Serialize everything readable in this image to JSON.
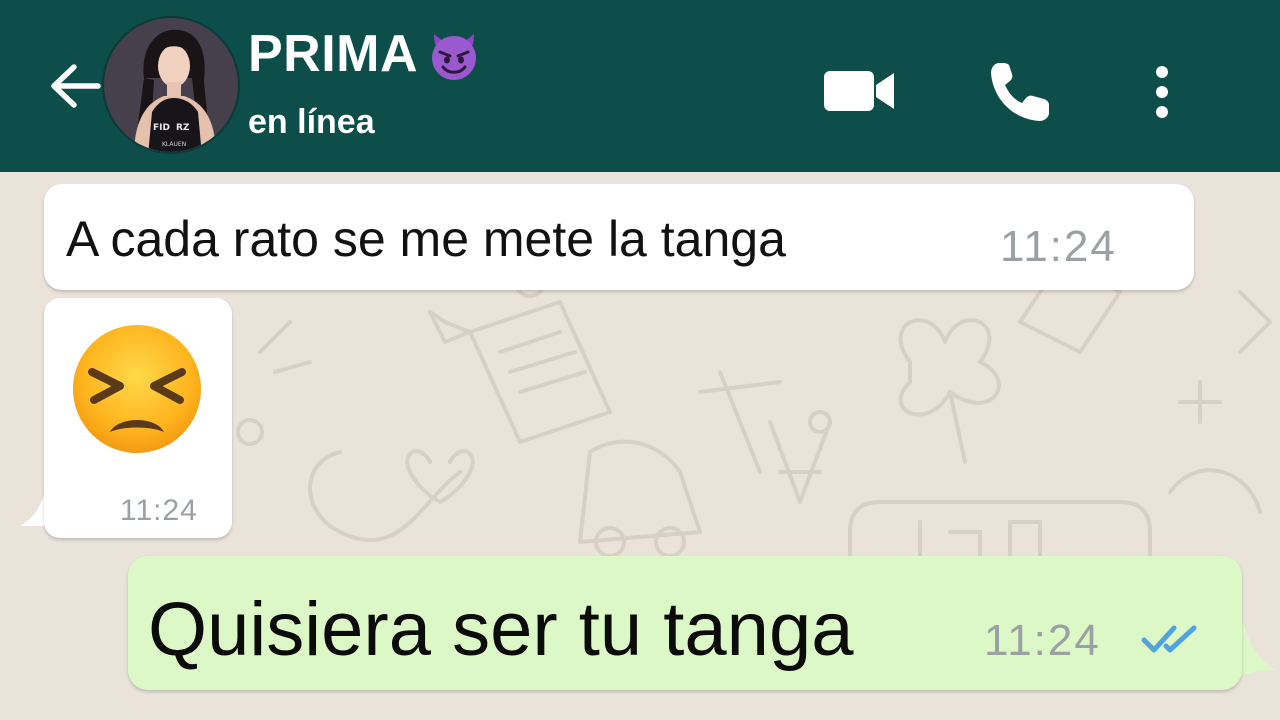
{
  "header": {
    "back_icon": "arrow-left-icon",
    "contact_name": "PRIMA",
    "contact_emoji": "smiling-face-with-horns-emoji",
    "status": "en línea",
    "avatar_text": [
      "FID",
      "RZ",
      "KLAUEN"
    ],
    "actions": [
      "video-call-icon",
      "phone-call-icon",
      "more-vertical-icon"
    ],
    "bg_color": "#0d4e4a"
  },
  "messages": [
    {
      "direction": "incoming",
      "text": "A cada rato se me mete la tanga",
      "time": "11:24"
    },
    {
      "direction": "incoming",
      "emoji": "persevering-face-emoji",
      "time": "11:24"
    },
    {
      "direction": "outgoing",
      "text": "Quisiera ser tu tanga",
      "time": "11:24",
      "status": "read-double-check-icon",
      "status_color": "#4fa3e0"
    }
  ],
  "colors": {
    "incoming_bubble": "#ffffff",
    "outgoing_bubble": "#dcf8c6",
    "chat_bg": "#e9e3da",
    "time_text": "#9aa0a3"
  }
}
